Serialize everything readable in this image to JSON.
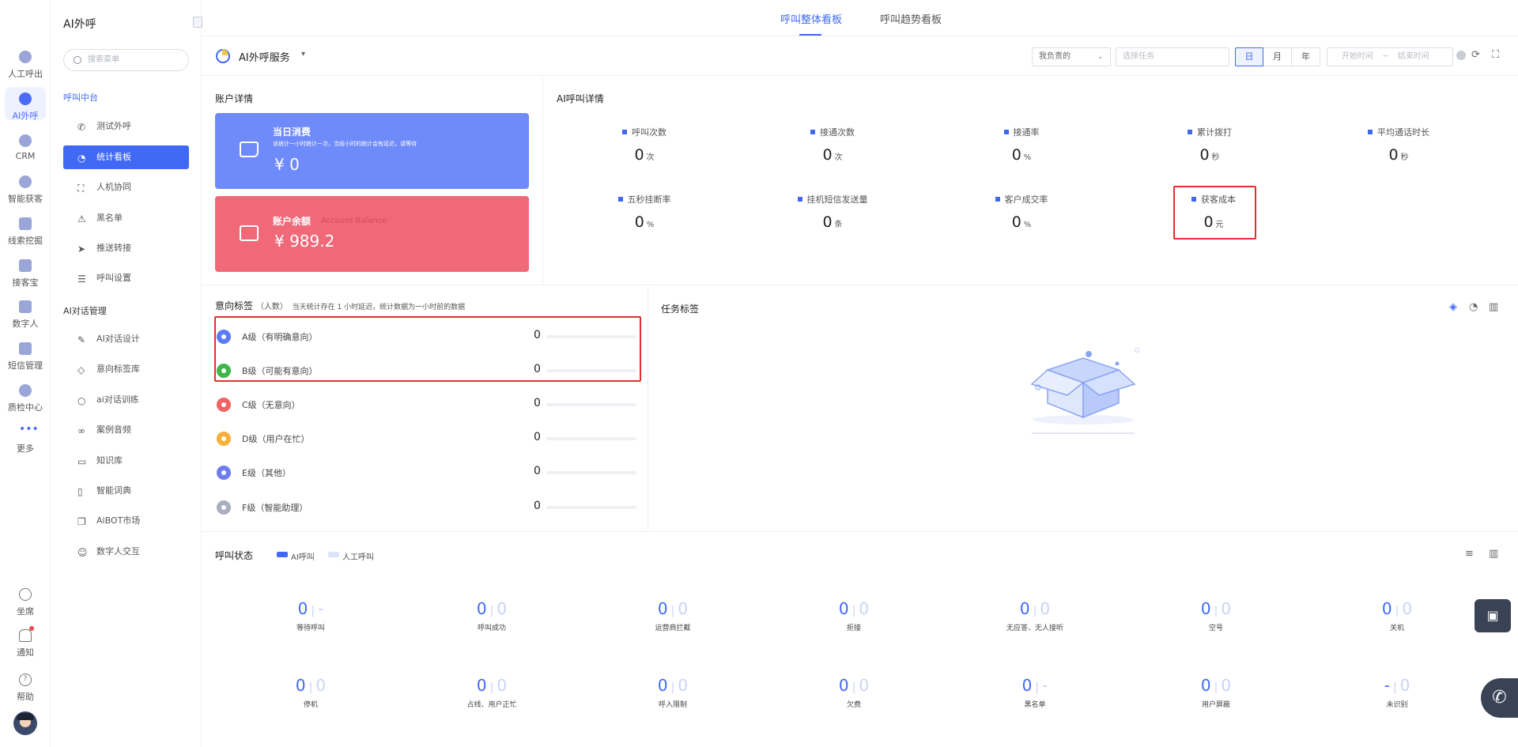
{
  "rail": {
    "items": [
      {
        "label": "人工呼出"
      },
      {
        "label": "AI外呼"
      },
      {
        "label": "CRM"
      },
      {
        "label": "智能获客"
      },
      {
        "label": "线索挖掘"
      },
      {
        "label": "接客宝"
      },
      {
        "label": "数字人"
      },
      {
        "label": "短信管理"
      },
      {
        "label": "质检中心"
      },
      {
        "label": "更多"
      }
    ],
    "bottom": [
      {
        "label": "坐席"
      },
      {
        "label": "通知"
      },
      {
        "label": "帮助"
      }
    ]
  },
  "sidebar": {
    "title": "AI外呼",
    "search_placeholder": "搜索菜单",
    "group1": "呼叫中台",
    "group1_items": [
      {
        "label": "测试外呼"
      },
      {
        "label": "统计看板"
      },
      {
        "label": "人机协同"
      },
      {
        "label": "黑名单"
      },
      {
        "label": "推送转接"
      },
      {
        "label": "呼叫设置"
      }
    ],
    "group2": "AI对话管理",
    "group2_items": [
      {
        "label": "AI对话设计"
      },
      {
        "label": "意向标签库"
      },
      {
        "label": "ai对话训练"
      },
      {
        "label": "案例音频"
      },
      {
        "label": "知识库"
      },
      {
        "label": "智能词典"
      },
      {
        "label": "AiBOT市场"
      },
      {
        "label": "数字人交互"
      }
    ]
  },
  "tabs": [
    "呼叫整体看板",
    "呼叫趋势看板"
  ],
  "toolbar": {
    "service": "AI外呼服务",
    "owner_select": "我负责的",
    "task_placeholder": "选择任务",
    "periods": [
      "日",
      "月",
      "年"
    ],
    "start_placeholder": "开始时间",
    "range_sep": "~",
    "end_placeholder": "结束时间"
  },
  "account": {
    "title": "账户详情",
    "today": {
      "title": "当日消费",
      "subtitle": "该统计一小时统计一次，当前小时的统计会有延迟，请等待",
      "value": "¥ 0"
    },
    "balance": {
      "title": "账户余额",
      "subtitle": "Account Balance",
      "value": "¥ 989.2"
    }
  },
  "ai_detail": {
    "title": "AI呼叫详情",
    "stats": [
      {
        "label": "呼叫次数",
        "value": "0",
        "unit": "次"
      },
      {
        "label": "接通次数",
        "value": "0",
        "unit": "次"
      },
      {
        "label": "接通率",
        "value": "0",
        "unit": "%"
      },
      {
        "label": "累计拨打",
        "value": "0",
        "unit": "秒"
      },
      {
        "label": "平均通话时长",
        "value": "0",
        "unit": "秒"
      },
      {
        "label": "五秒挂断率",
        "value": "0",
        "unit": "%"
      },
      {
        "label": "挂机短信发送量",
        "value": "0",
        "unit": "条"
      },
      {
        "label": "客户成交率",
        "value": "0",
        "unit": "%"
      },
      {
        "label": "获客成本",
        "value": "0",
        "unit": "元"
      }
    ]
  },
  "intent": {
    "title": "意向标签",
    "unit_note": "（人数）",
    "note": "当天统计存在 1 小时延迟，统计数据为一小时前的数据",
    "rows": [
      {
        "label": "A级（有明确意向）",
        "value": 0,
        "color": "#5b7cf5"
      },
      {
        "label": "B级（可能有意向）",
        "value": 0,
        "color": "#3fb54a"
      },
      {
        "label": "C级（无意向）",
        "value": 0,
        "color": "#f06464"
      },
      {
        "label": "D级（用户在忙）",
        "value": 0,
        "color": "#f6b13a"
      },
      {
        "label": "E级（其他）",
        "value": 0,
        "color": "#6f7cf0"
      },
      {
        "label": "F级（智能助理）",
        "value": 0,
        "color": "#a9afbf"
      }
    ]
  },
  "task_tags": {
    "title": "任务标签"
  },
  "call_status": {
    "title": "呼叫状态",
    "legend": [
      "AI呼叫",
      "人工呼叫"
    ],
    "legend_colors": [
      "#3f68f3",
      "#dbe2fb"
    ],
    "items": [
      {
        "label": "等待呼叫",
        "a": "0",
        "b": "-"
      },
      {
        "label": "呼叫成功",
        "a": "0",
        "b": "0"
      },
      {
        "label": "运营商拦截",
        "a": "0",
        "b": "0"
      },
      {
        "label": "拒接",
        "a": "0",
        "b": "0"
      },
      {
        "label": "无应答、无人接听",
        "a": "0",
        "b": "0"
      },
      {
        "label": "空号",
        "a": "0",
        "b": "0"
      },
      {
        "label": "关机",
        "a": "0",
        "b": "0"
      },
      {
        "label": "停机",
        "a": "0",
        "b": "0"
      },
      {
        "label": "占线、用户正忙",
        "a": "0",
        "b": "0"
      },
      {
        "label": "呼入限制",
        "a": "0",
        "b": "0"
      },
      {
        "label": "欠费",
        "a": "0",
        "b": "0"
      },
      {
        "label": "黑名单",
        "a": "0",
        "b": "-"
      },
      {
        "label": "用户屏蔽",
        "a": "0",
        "b": "0"
      },
      {
        "label": "未识别",
        "a": "-",
        "b": "0"
      }
    ]
  }
}
